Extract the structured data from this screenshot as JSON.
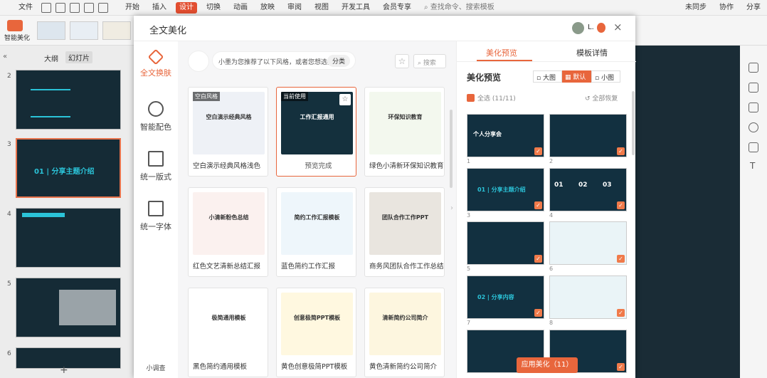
{
  "menubar": {
    "file": "文件",
    "items": [
      "开始",
      "插入",
      "设计",
      "切换",
      "动画",
      "放映",
      "审阅",
      "视图",
      "开发工具",
      "会员专享"
    ],
    "search_placeholder": "查找命令、搜索模板",
    "sync": "未同步",
    "collab": "协作",
    "share": "分享"
  },
  "ribbon": {
    "smart_beautify": "智能美化"
  },
  "leftpanel": {
    "tab_outline": "大纲",
    "tab_slides": "幻灯片",
    "slide_numbers": [
      "2",
      "3",
      "4",
      "5",
      "6"
    ],
    "slide3_text": "01 | 分享主题介绍"
  },
  "dialog": {
    "title": "全文美化",
    "user": "L.",
    "nav": [
      "全文换肤",
      "智能配色",
      "统一版式",
      "统一字体",
      "小调查"
    ],
    "suggest": {
      "text": "小墨为您推荐了以下风格，或者您想选择",
      "button": "分类",
      "search_placeholder": "搜索"
    },
    "cards": [
      {
        "label": "空白演示经典风格浅色",
        "tag": "空白风格",
        "title": "空白演示经典风格",
        "bg": "#eef1f6"
      },
      {
        "label": "预览完成",
        "tag": "当前使用",
        "title": "工作汇报通用",
        "bg": "#14303d"
      },
      {
        "label": "绿色小清新环保知识教育",
        "tag": "",
        "title": "环保知识教育",
        "bg": "#f3f8ee"
      },
      {
        "label": "红色文艺清新总结汇报",
        "tag": "",
        "title": "小清新粉色总结",
        "bg": "#fbf1ef"
      },
      {
        "label": "蓝色简约工作汇报",
        "tag": "",
        "title": "简约工作汇报模板",
        "bg": "#eef6fb"
      },
      {
        "label": "商务风团队合作工作总结...",
        "tag": "",
        "title": "团队合作工作PPT",
        "bg": "#e9e5df"
      },
      {
        "label": "黑色简约通用模板",
        "tag": "",
        "title": "极简通用模板",
        "bg": "#ffffff"
      },
      {
        "label": "黄色创意极简PPT模板",
        "tag": "",
        "title": "创意极简PPT模板",
        "bg": "#fff8e0"
      },
      {
        "label": "黄色清新简约公司简介",
        "tag": "",
        "title": "清新简约公司简介",
        "bg": "#fdf6df"
      }
    ],
    "side": {
      "tab_preview": "美化预览",
      "tab_detail": "模板详情",
      "heading": "美化预览",
      "view_large": "大图",
      "view_default": "默认",
      "view_small": "小图",
      "select_all": "全选 (11/11)",
      "restore": "全部恢复",
      "apply": "应用美化（11）",
      "slide1_title": "个人分享会",
      "slide3_title": "01 | 分享主题介绍",
      "slide4_nums": [
        "01",
        "02",
        "03"
      ],
      "slide7_title": "02 | 分享内容",
      "nums": [
        "1",
        "2",
        "3",
        "4",
        "5",
        "6",
        "7",
        "8"
      ]
    }
  },
  "colors": {
    "accent": "#e8663c",
    "dark_slide": "#14303d",
    "teal": "#2bc3d8"
  }
}
